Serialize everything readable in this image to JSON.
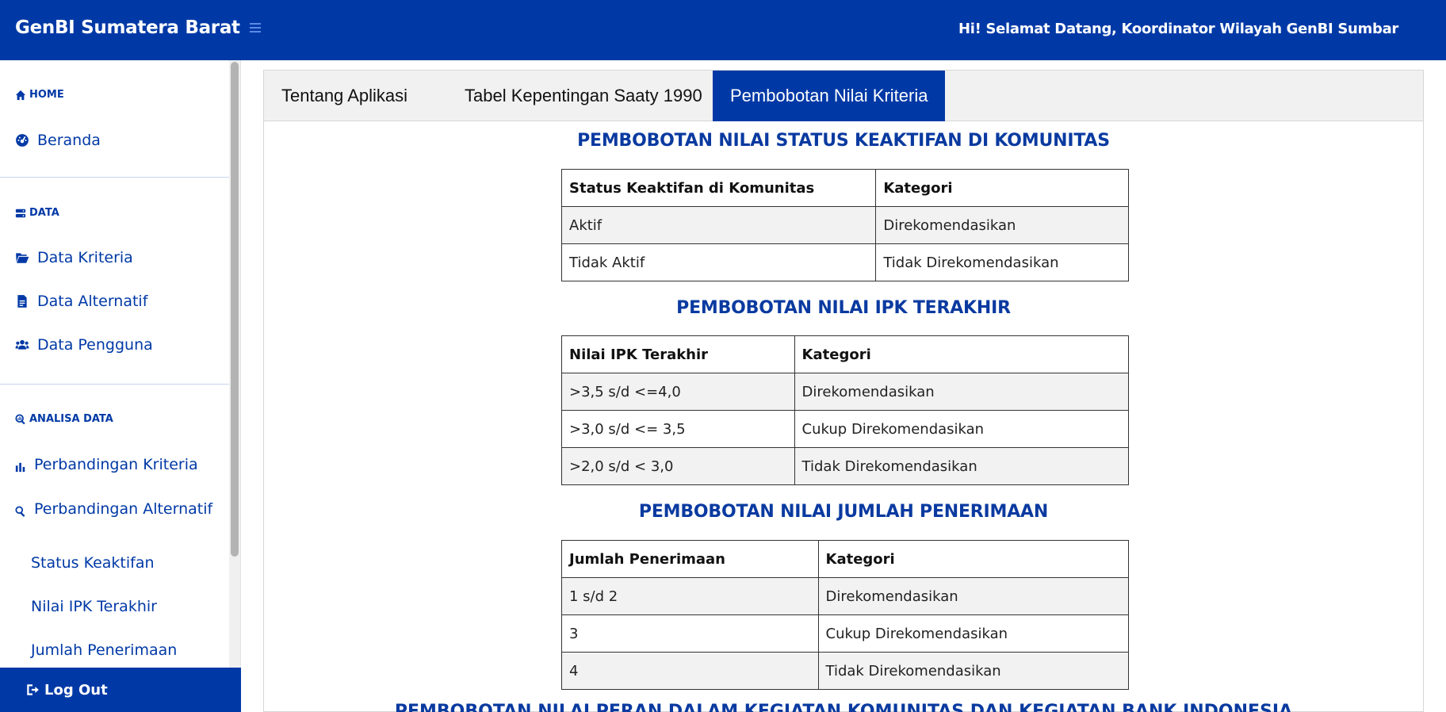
{
  "header": {
    "brand": "GenBI Sumatera Barat",
    "welcome": "Hi! Selamat Datang, Koordinator Wilayah GenBI Sumbar"
  },
  "sidebar": {
    "sections": {
      "home": "HOME",
      "data": "DATA",
      "analisa": "ANALISA DATA"
    },
    "items": {
      "beranda": "Beranda",
      "data_kriteria": "Data Kriteria",
      "data_alternatif": "Data Alternatif",
      "data_pengguna": "Data Pengguna",
      "perbandingan_kriteria": "Perbandingan Kriteria",
      "perbandingan_alternatif": "Perbandingan Alternatif",
      "status_keaktifan": "Status Keaktifan",
      "nilai_ipk": "Nilai IPK Terakhir",
      "jumlah_penerimaan": "Jumlah Penerimaan"
    },
    "logout": "Log Out"
  },
  "tabs": [
    {
      "label": "Tentang Aplikasi",
      "active": false
    },
    {
      "label": "Tabel Kepentingan Saaty 1990",
      "active": false
    },
    {
      "label": "Pembobotan Nilai Kriteria",
      "active": true
    }
  ],
  "sections": [
    {
      "title": "PEMBOBOTAN NILAI STATUS KEAKTIFAN DI KOMUNITAS",
      "headers": [
        "Status Keaktifan di Komunitas",
        "Kategori"
      ],
      "rows": [
        [
          "Aktif",
          "Direkomendasikan"
        ],
        [
          "Tidak Aktif",
          "Tidak Direkomendasikan"
        ]
      ]
    },
    {
      "title": "PEMBOBOTAN NILAI IPK TERAKHIR",
      "headers": [
        "Nilai IPK Terakhir",
        "Kategori"
      ],
      "rows": [
        [
          ">3,5 s/d <=4,0",
          "Direkomendasikan"
        ],
        [
          ">3,0 s/d <= 3,5",
          "Cukup Direkomendasikan"
        ],
        [
          ">2,0 s/d < 3,0",
          "Tidak Direkomendasikan"
        ]
      ]
    },
    {
      "title": "PEMBOBOTAN NILAI JUMLAH PENERIMAAN",
      "headers": [
        "Jumlah Penerimaan",
        "Kategori"
      ],
      "rows": [
        [
          "1 s/d 2",
          "Direkomendasikan"
        ],
        [
          "3",
          "Cukup Direkomendasikan"
        ],
        [
          "4",
          "Tidak Direkomendasikan"
        ]
      ]
    }
  ],
  "bottom_partial_title": "PEMBOBOTAN NILAI PERAN DALAM KEGIATAN KOMUNITAS DAN KEGIATAN BANK INDONESIA",
  "colors": {
    "primary": "#0039a6",
    "heading": "#0a3aa0",
    "row_alt": "#f2f2f2"
  }
}
